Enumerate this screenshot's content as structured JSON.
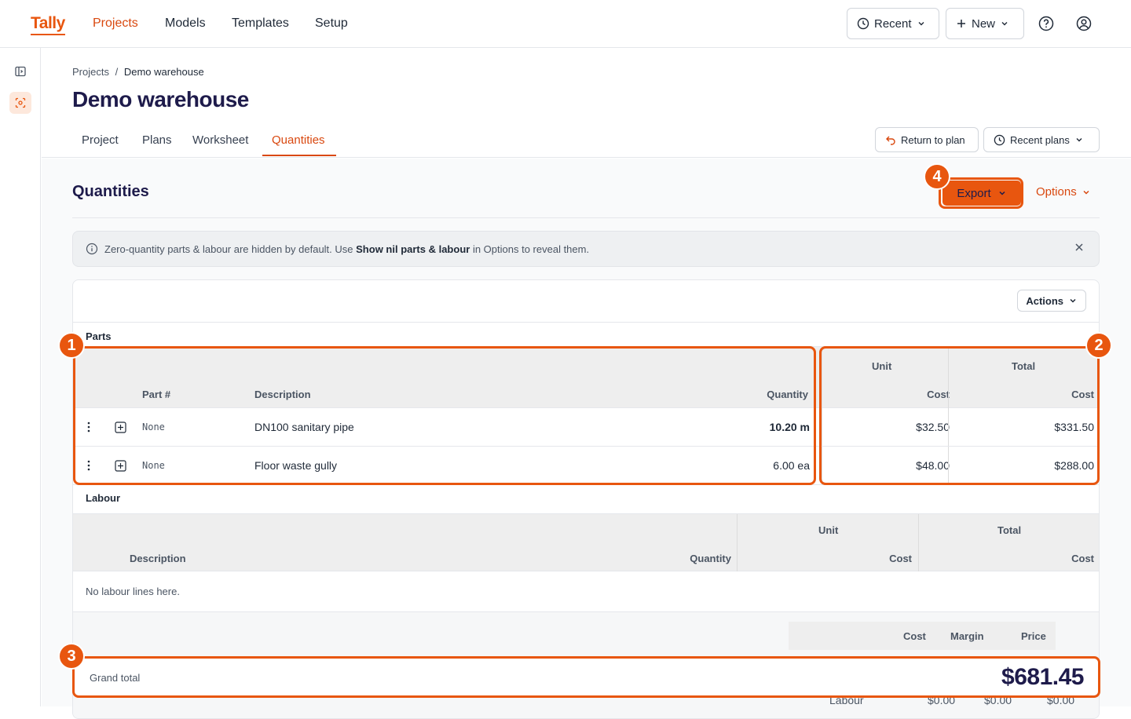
{
  "app": {
    "logo": "Tally"
  },
  "nav": {
    "items": [
      "Projects",
      "Models",
      "Templates",
      "Setup"
    ],
    "active": "Projects"
  },
  "toolbar": {
    "recent_label": "Recent",
    "new_label": "New"
  },
  "breadcrumb": {
    "root": "Projects",
    "separator": "/",
    "current": "Demo warehouse"
  },
  "page": {
    "title": "Demo warehouse"
  },
  "tabs": [
    "Project",
    "Plans",
    "Worksheet",
    "Quantities"
  ],
  "tab_active": "Quantities",
  "header_buttons": {
    "return_label": "Return to plan",
    "recent_plans_label": "Recent plans"
  },
  "quantities": {
    "title": "Quantities",
    "export_label": "Export",
    "options_label": "Options",
    "banner": {
      "prefix": "Zero-quantity parts & labour are hidden by default. Use",
      "bold": "Show nil parts & labour",
      "suffix": "in Options to reveal them."
    },
    "actions_label": "Actions"
  },
  "parts": {
    "label": "Parts",
    "headers": {
      "part": "Part #",
      "description": "Description",
      "quantity": "Quantity",
      "unit_top": "Unit",
      "unit_bottom": "Cost",
      "total_top": "Total",
      "total_bottom": "Cost"
    },
    "rows": [
      {
        "part": "None",
        "description": "DN100 sanitary pipe",
        "quantity": "10.20 m",
        "unit_cost": "$32.50",
        "total_cost": "$331.50"
      },
      {
        "part": "None",
        "description": "Floor waste gully",
        "quantity": "6.00 ea",
        "unit_cost": "$48.00",
        "total_cost": "$288.00"
      }
    ]
  },
  "labour": {
    "label": "Labour",
    "headers": {
      "description": "Description",
      "quantity": "Quantity",
      "unit_top": "Unit",
      "unit_bottom": "Cost",
      "total_top": "Total",
      "total_bottom": "Cost"
    },
    "empty": "No labour lines here."
  },
  "summary": {
    "headers": {
      "cost": "Cost",
      "margin": "Margin",
      "price": "Price"
    },
    "grand_total_label": "Grand total",
    "grand_total_value": "$681.45",
    "labour_row": {
      "label": "Labour",
      "cost": "$0.00",
      "margin": "$0.00",
      "price": "$0.00"
    }
  },
  "annotations": [
    "1",
    "2",
    "3",
    "4"
  ],
  "colors": {
    "accent": "#e8560f",
    "title": "#1e1b4b"
  }
}
